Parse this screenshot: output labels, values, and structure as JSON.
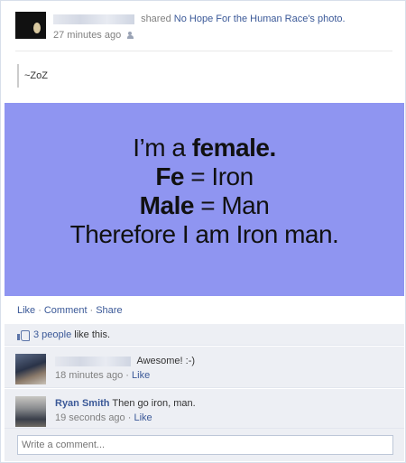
{
  "post": {
    "shared_verb": "shared",
    "shared_target": "No Hope For the Human Race's photo.",
    "timestamp": "27 minutes ago",
    "privacy_icon": "friends-icon",
    "message": "~ZoZ"
  },
  "photo": {
    "line1_normal": "I’m a ",
    "line1_bold": "female.",
    "line2_bold": "Fe",
    "line2_normal": " = Iron",
    "line3_bold": "Male",
    "line3_normal": " = Man",
    "line4": "Therefore I am Iron man.",
    "background": "#8f95f1"
  },
  "actions": {
    "like": "Like",
    "comment": "Comment",
    "share": "Share",
    "separator": "·"
  },
  "likes": {
    "count_text": "3 people",
    "suffix": " like this.",
    "icon": "thumbs-up-icon"
  },
  "comments": [
    {
      "author": "",
      "text": "Awesome! :-)",
      "time": "18 minutes ago",
      "like": "Like"
    },
    {
      "author": "Ryan Smith",
      "text": "Then go iron, man.",
      "time": "19 seconds ago",
      "like": "Like"
    }
  ],
  "composer": {
    "placeholder": "Write a comment..."
  },
  "colors": {
    "link": "#3b5998",
    "muted": "#808080",
    "feedback_bg": "#edeff4"
  }
}
